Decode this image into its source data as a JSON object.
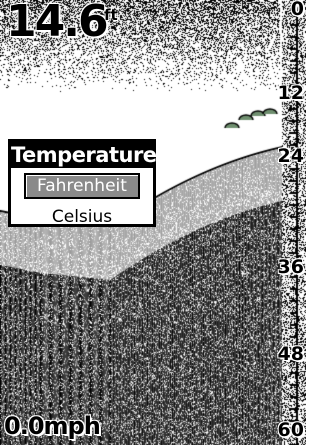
{
  "readouts": {
    "depth_value": "14.6",
    "depth_unit": "ft",
    "speed": "0.0mph"
  },
  "depth_scale": {
    "ticks": [
      "0",
      "12",
      "24",
      "36",
      "48",
      "60"
    ]
  },
  "menu": {
    "title": "Temperature",
    "options": [
      {
        "label": "Fahrenheit",
        "selected": true
      },
      {
        "label": "Celsius",
        "selected": false
      }
    ]
  },
  "colors": {
    "background": "#ffffff",
    "bottom_gray": "#9a9a9a",
    "bottom_black": "#000000",
    "fish_arch": "#6f8f6f"
  }
}
